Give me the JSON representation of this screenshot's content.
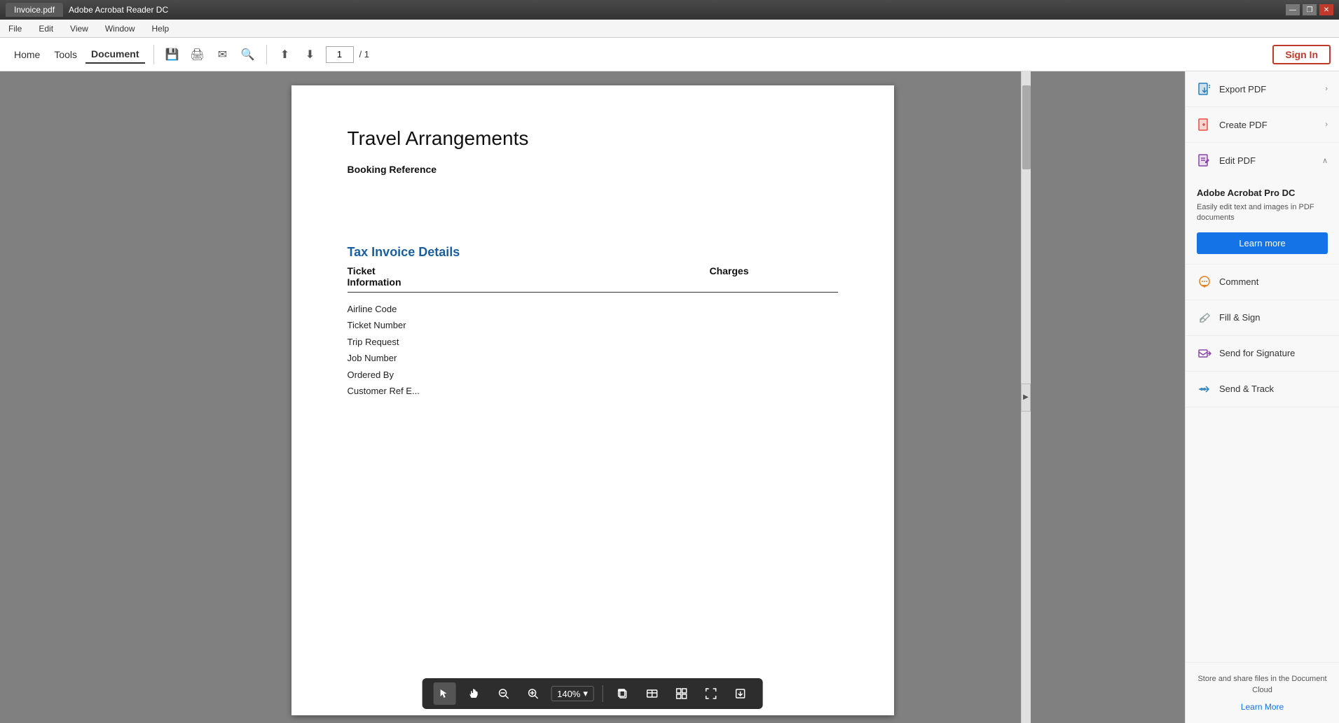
{
  "titleBar": {
    "tab": "Invoice.pdf",
    "appName": "Adobe Acrobat Reader DC",
    "minimizeBtn": "—",
    "restoreBtn": "❐",
    "closeBtn": "✕"
  },
  "menuBar": {
    "items": [
      "File",
      "Edit",
      "View",
      "Window",
      "Help"
    ]
  },
  "toolbar": {
    "tabs": [
      {
        "label": "Home",
        "active": false
      },
      {
        "label": "Tools",
        "active": false
      },
      {
        "label": "Document",
        "active": true
      }
    ],
    "pageInput": "1",
    "pageTotal": "/ 1",
    "signIn": "Sign In"
  },
  "pdfContent": {
    "title": "Travel Arrangements",
    "bookingLabel": "Booking Reference",
    "sectionTitle": "Tax Invoice Details",
    "ticketInfoHeader": "Ticket Information",
    "chargesHeader": "Charges",
    "rows": [
      "Airline Code",
      "Ticket Number",
      "Trip Request",
      "Job Number",
      "Ordered By",
      "Customer Ref E..."
    ]
  },
  "bottomToolbar": {
    "zoomLevel": "140%",
    "tools": [
      "selector",
      "hand",
      "zoomOut",
      "zoomIn",
      "copy",
      "table",
      "grid",
      "expand",
      "extract"
    ]
  },
  "rightPanel": {
    "exportPdf": {
      "label": "Export PDF",
      "hasChevron": true
    },
    "createPdf": {
      "label": "Create PDF",
      "hasChevron": true
    },
    "editPdf": {
      "label": "Edit PDF",
      "hasChevron": true,
      "expanded": true
    },
    "promo": {
      "title": "Adobe Acrobat Pro DC",
      "description": "Easily edit text and images in PDF documents",
      "learnMoreBtn": "Learn more"
    },
    "comment": {
      "label": "Comment"
    },
    "fillSign": {
      "label": "Fill & Sign"
    },
    "sendSignature": {
      "label": "Send for Signature"
    },
    "sendTrack": {
      "label": "Send & Track"
    },
    "bottomPromo": {
      "text": "Store and share files in the Document Cloud",
      "link": "Learn More"
    }
  }
}
